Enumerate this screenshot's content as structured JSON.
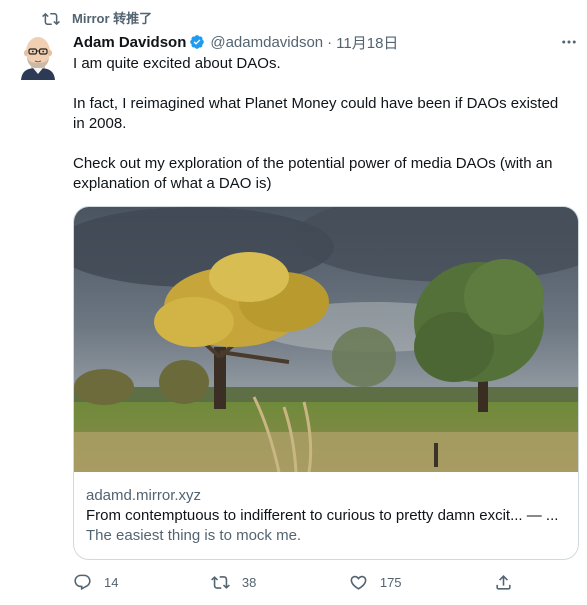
{
  "retweet": {
    "label": "Mirror 转推了"
  },
  "author": {
    "name": "Adam Davidson",
    "handle": "@adamdavidson",
    "separator": "·",
    "date": "11月18日"
  },
  "tweet_text": {
    "p1": "I am quite excited about DAOs.",
    "p2": "In fact, I reimagined what Planet Money could have been if DAOs existed in 2008.",
    "p3": "Check out my exploration of the potential power of media DAOs (with an explanation of what a DAO is)"
  },
  "link_card": {
    "domain": "adamd.mirror.xyz",
    "title": "From contemptuous to indifferent to curious to pretty damn excit... — ...",
    "description": "The easiest thing is to mock me."
  },
  "actions": {
    "reply_count": "14",
    "retweet_count": "38",
    "like_count": "175"
  },
  "icons": {
    "retweet": "retweet-icon",
    "verified": "verified-badge-icon",
    "more": "more-icon",
    "reply": "reply-icon",
    "like": "heart-icon",
    "share": "share-icon"
  },
  "colors": {
    "text_primary": "#0f1419",
    "text_secondary": "#536471",
    "verified_blue": "#1d9bf0",
    "card_border": "#cfd9de"
  }
}
